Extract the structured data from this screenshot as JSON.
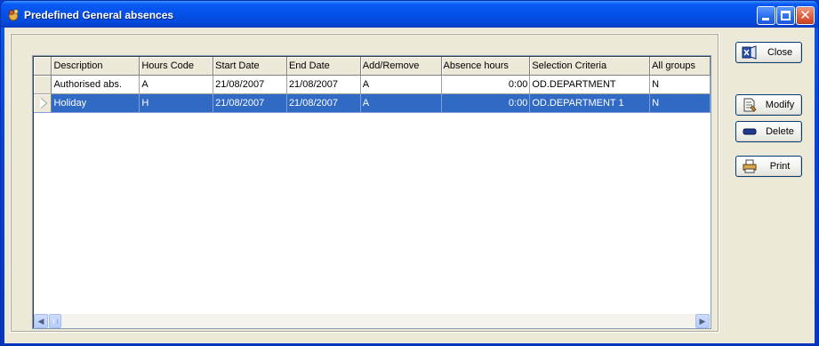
{
  "window": {
    "title": "Predefined General absences"
  },
  "grid": {
    "columns": [
      "Description",
      "Hours Code",
      "Start Date",
      "End Date",
      "Add/Remove",
      "Absence hours",
      "Selection Criteria",
      "All groups"
    ],
    "rows": [
      {
        "description": "Authorised abs.",
        "hours_code": "A",
        "start_date": "21/08/2007",
        "end_date": "21/08/2007",
        "add_remove": "A",
        "absence_hours": "0:00",
        "selection_criteria": "OD.DEPARTMENT",
        "all_groups": "N",
        "selected": false
      },
      {
        "description": "Holiday",
        "hours_code": "H",
        "start_date": "21/08/2007",
        "end_date": "21/08/2007",
        "add_remove": "A",
        "absence_hours": "0:00",
        "selection_criteria": "OD.DEPARTMENT 1",
        "all_groups": "N",
        "selected": true
      }
    ]
  },
  "buttons": {
    "close_label": "Close",
    "modify_label": "Modify",
    "delete_label": "Delete",
    "print_label": "Print"
  },
  "icons": {
    "app": "app-icon",
    "close": "close-door-icon",
    "modify": "document-edit-icon",
    "delete": "minus-bar-icon",
    "print": "printer-icon"
  },
  "colors": {
    "titlebar": "#0451e8",
    "selection": "#316ac5",
    "dialog_face": "#ece9d8"
  }
}
